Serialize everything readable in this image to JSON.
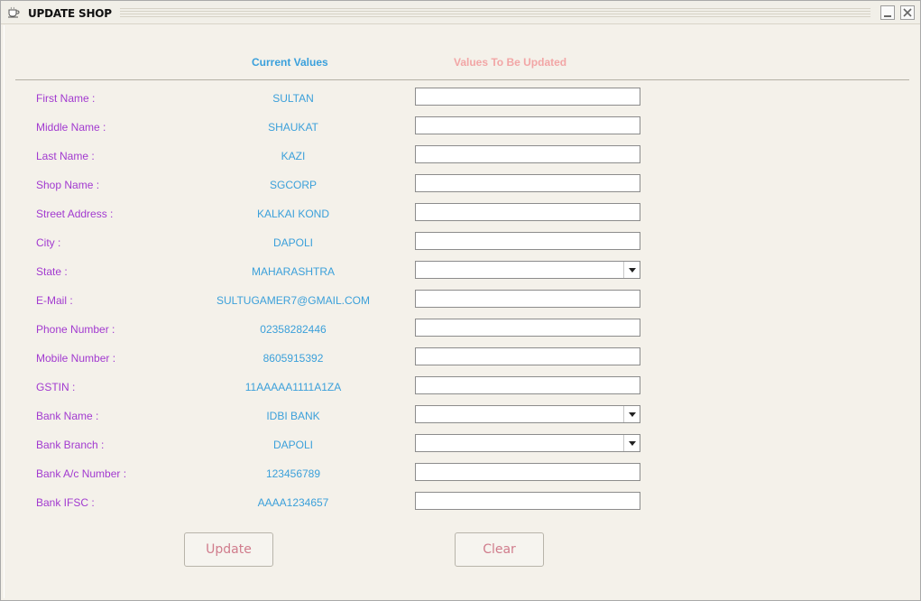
{
  "window": {
    "title": "UPDATE SHOP"
  },
  "headers": {
    "current": "Current Values",
    "update": "Values To Be Updated"
  },
  "fields": [
    {
      "label": "First Name :",
      "value": "SULTAN",
      "control": "input",
      "input_value": ""
    },
    {
      "label": "Middle Name :",
      "value": "SHAUKAT",
      "control": "input",
      "input_value": ""
    },
    {
      "label": "Last Name :",
      "value": "KAZI",
      "control": "input",
      "input_value": ""
    },
    {
      "label": "Shop Name :",
      "value": "SGCORP",
      "control": "input",
      "input_value": ""
    },
    {
      "label": "Street Address :",
      "value": "KALKAI KOND",
      "control": "input",
      "input_value": ""
    },
    {
      "label": "City :",
      "value": "DAPOLI",
      "control": "input",
      "input_value": ""
    },
    {
      "label": "State :",
      "value": "MAHARASHTRA",
      "control": "select",
      "input_value": ""
    },
    {
      "label": "E-Mail :",
      "value": "SULTUGAMER7@GMAIL.COM",
      "control": "input",
      "input_value": ""
    },
    {
      "label": "Phone Number :",
      "value": "02358282446",
      "control": "input",
      "input_value": ""
    },
    {
      "label": "Mobile Number :",
      "value": "8605915392",
      "control": "input",
      "input_value": ""
    },
    {
      "label": "GSTIN :",
      "value": "11AAAAA1111A1ZA",
      "control": "input",
      "input_value": ""
    },
    {
      "label": "Bank Name :",
      "value": "IDBI BANK",
      "control": "select",
      "input_value": ""
    },
    {
      "label": "Bank Branch :",
      "value": "DAPOLI",
      "control": "select",
      "input_value": ""
    },
    {
      "label": "Bank A/c Number :",
      "value": "123456789",
      "control": "input",
      "input_value": ""
    },
    {
      "label": "Bank IFSC :",
      "value": "AAAA1234657",
      "control": "input",
      "input_value": ""
    }
  ],
  "buttons": {
    "update": "Update",
    "clear": "Clear"
  },
  "icons": {
    "title": "coffee-cup-icon",
    "minimize": "minimize-icon",
    "close": "close-icon",
    "dropdown": "chevron-down-icon"
  },
  "colors": {
    "label": "#a23ad0",
    "value": "#3ba0da",
    "header_current": "#3aa0dc",
    "header_update": "#f2a6a6",
    "button_text": "#d07c8c"
  }
}
